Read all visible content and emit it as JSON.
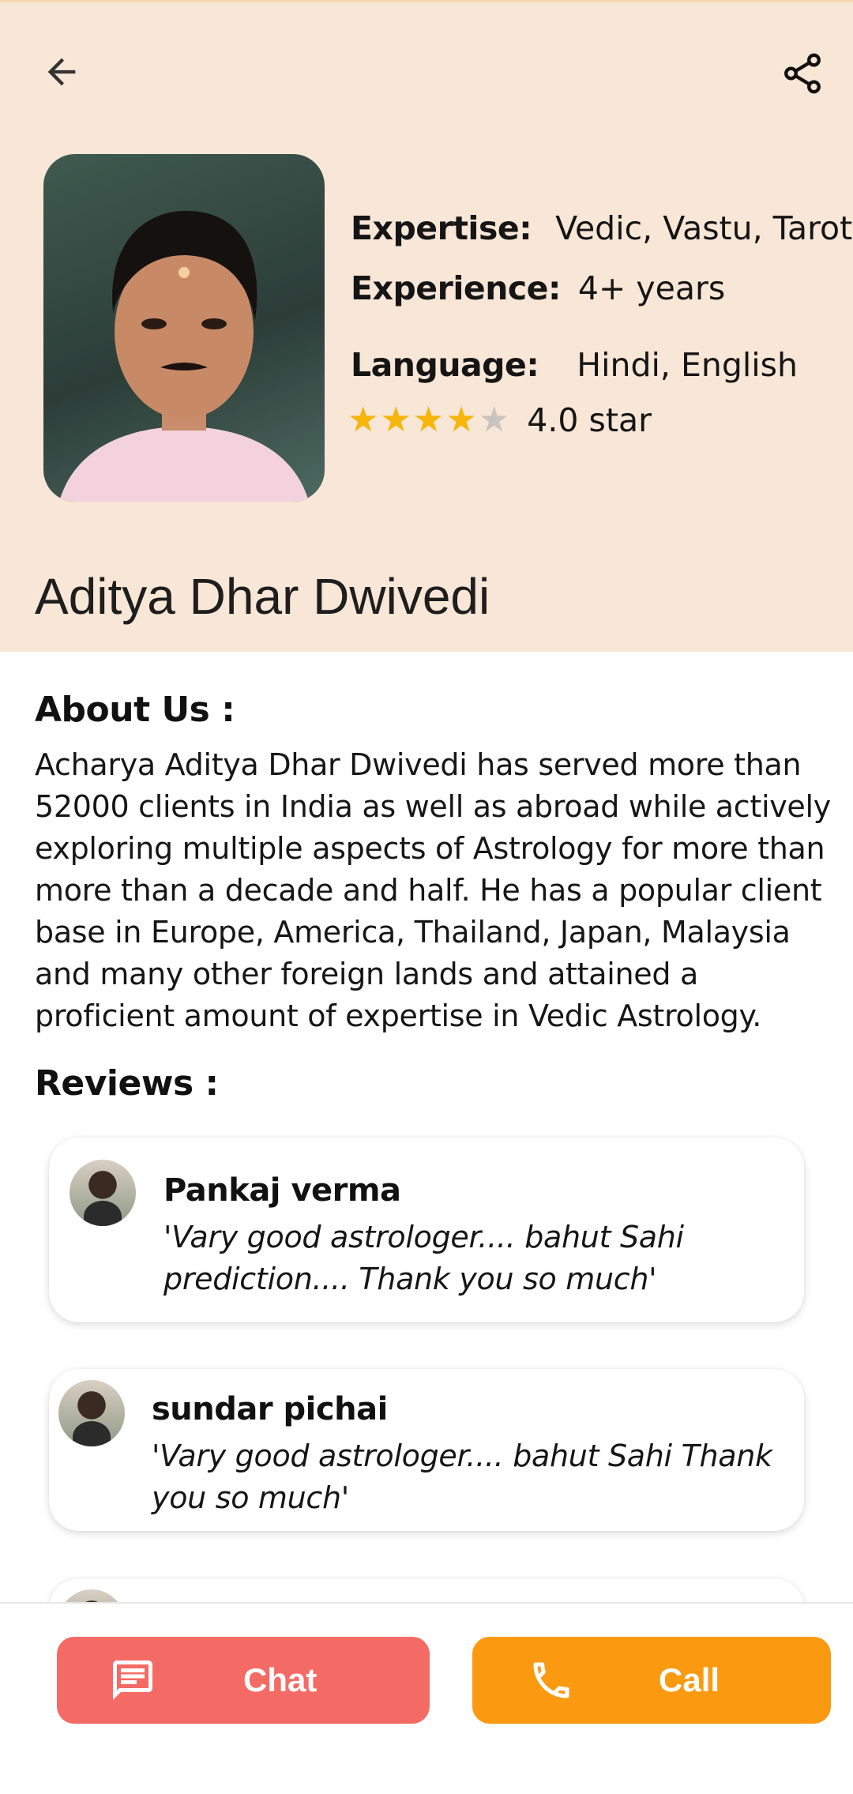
{
  "header": {
    "back_icon": "arrow-left-icon",
    "share_icon": "share-icon",
    "background": "#f8e6d6"
  },
  "profile": {
    "name": "Aditya Dhar Dwivedi",
    "expertise_label": "Expertise:",
    "expertise_value": "Vedic, Vastu, Tarot",
    "experience_label": "Experience:",
    "experience_value": "4+ years",
    "language_label": "Language:",
    "language_value": "Hindi, English",
    "rating": 4,
    "rating_max": 5,
    "rating_text": "4.0 star"
  },
  "about": {
    "title": "About Us :",
    "text": "Acharya Aditya Dhar Dwivedi has served more than 52000 clients in India as well as abroad while actively exploring multiple aspects of Astrology for more than more than a decade and half. He has a popular client base in Europe, America, Thailand, Japan, Malaysia and many other foreign lands and attained a proficient amount of expertise in Vedic Astrology."
  },
  "reviews": {
    "title": "Reviews :",
    "items": [
      {
        "name": "Pankaj verma",
        "text": "'Vary good astrologer.... bahut Sahi prediction.... Thank you so much'"
      },
      {
        "name": "sundar pichai",
        "text": "'Vary good astrologer.... bahut Sahi  Thank you so much'"
      }
    ]
  },
  "actions": {
    "chat_label": "Chat",
    "call_label": "Call",
    "chat_icon": "chat-icon",
    "call_icon": "phone-icon",
    "chat_color": "#f46b66",
    "call_color": "#fb9a10"
  }
}
